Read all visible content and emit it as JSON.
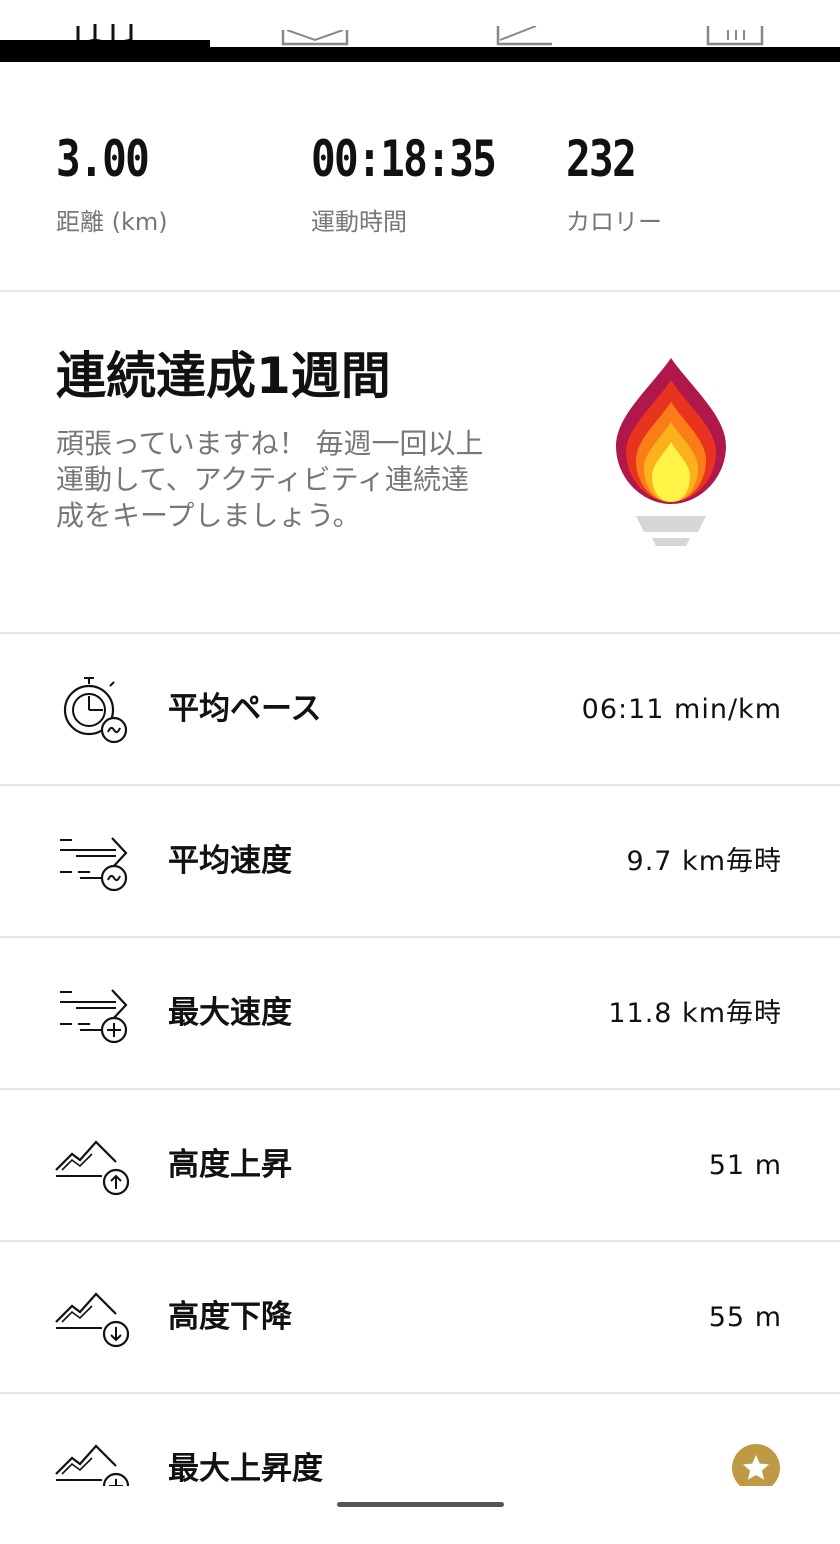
{
  "tabs": [
    {
      "icon": "map-icon"
    },
    {
      "icon": "photo-icon"
    },
    {
      "icon": "chart-icon"
    },
    {
      "icon": "laps-icon"
    }
  ],
  "summary": {
    "distance": {
      "value": "3.00",
      "label": "距離 (km)"
    },
    "duration": {
      "value": "00:18:35",
      "label": "運動時間"
    },
    "calories": {
      "value": "232",
      "label": "カロリー"
    }
  },
  "streak": {
    "title": "連続達成1週間",
    "description": "頑張っていますね！ 毎週一回以上運動して、アクティビティ連続達成をキープしましょう。",
    "icon": "flame-torch-icon",
    "colors": [
      "#b0174a",
      "#e8341f",
      "#fb7d18",
      "#fbb01e",
      "#fff445"
    ]
  },
  "metrics": [
    {
      "label": "平均ペース",
      "value": "06:11 min/km",
      "icon": "stopwatch-avg-icon"
    },
    {
      "label": "平均速度",
      "value": "9.7 km毎時",
      "icon": "speed-avg-icon"
    },
    {
      "label": "最大速度",
      "value": "11.8 km毎時",
      "icon": "speed-max-icon"
    },
    {
      "label": "高度上昇",
      "value": "51 m",
      "icon": "elevation-up-icon"
    },
    {
      "label": "高度下降",
      "value": "55 m",
      "icon": "elevation-down-icon"
    },
    {
      "label": "最大上昇度",
      "value": "",
      "icon": "elevation-max-icon",
      "badge": "star-badge-icon"
    }
  ],
  "colors": {
    "badge_gold": "#bf9a44",
    "label_gray": "#777777"
  }
}
